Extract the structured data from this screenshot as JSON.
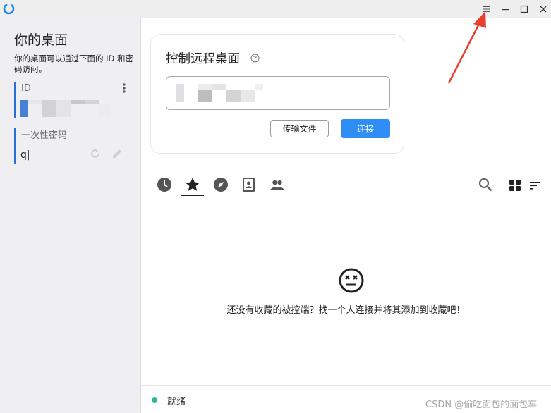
{
  "window": {
    "buttons": [
      "menu-icon",
      "minimize-icon",
      "maximize-icon",
      "close-icon"
    ]
  },
  "left": {
    "title": "你的桌面",
    "description": "你的桌面可以通过下面的 ID 和密码访问。",
    "id_label": "ID",
    "password_label": "一次性密码",
    "password_value": "q|"
  },
  "control": {
    "title": "控制远程桌面",
    "transfer_label": "传输文件",
    "connect_label": "连接"
  },
  "tabs": [
    {
      "name": "recent",
      "icon": "clock-icon"
    },
    {
      "name": "favorites",
      "icon": "star-icon",
      "active": true
    },
    {
      "name": "discovered",
      "icon": "compass-icon"
    },
    {
      "name": "address-book",
      "icon": "address-book-icon"
    },
    {
      "name": "group",
      "icon": "people-icon"
    }
  ],
  "empty": {
    "message": "还没有收藏的被控端？找一个人连接并将其添加到收藏吧！"
  },
  "status": {
    "text": "就绪"
  },
  "watermark": "CSDN @偷吃面包的面包车",
  "colors": {
    "accent": "#2f8ef5",
    "status_ok": "#2fb39a",
    "sidebar_bg": "#efeff2",
    "annotation_arrow": "#e8402f"
  }
}
